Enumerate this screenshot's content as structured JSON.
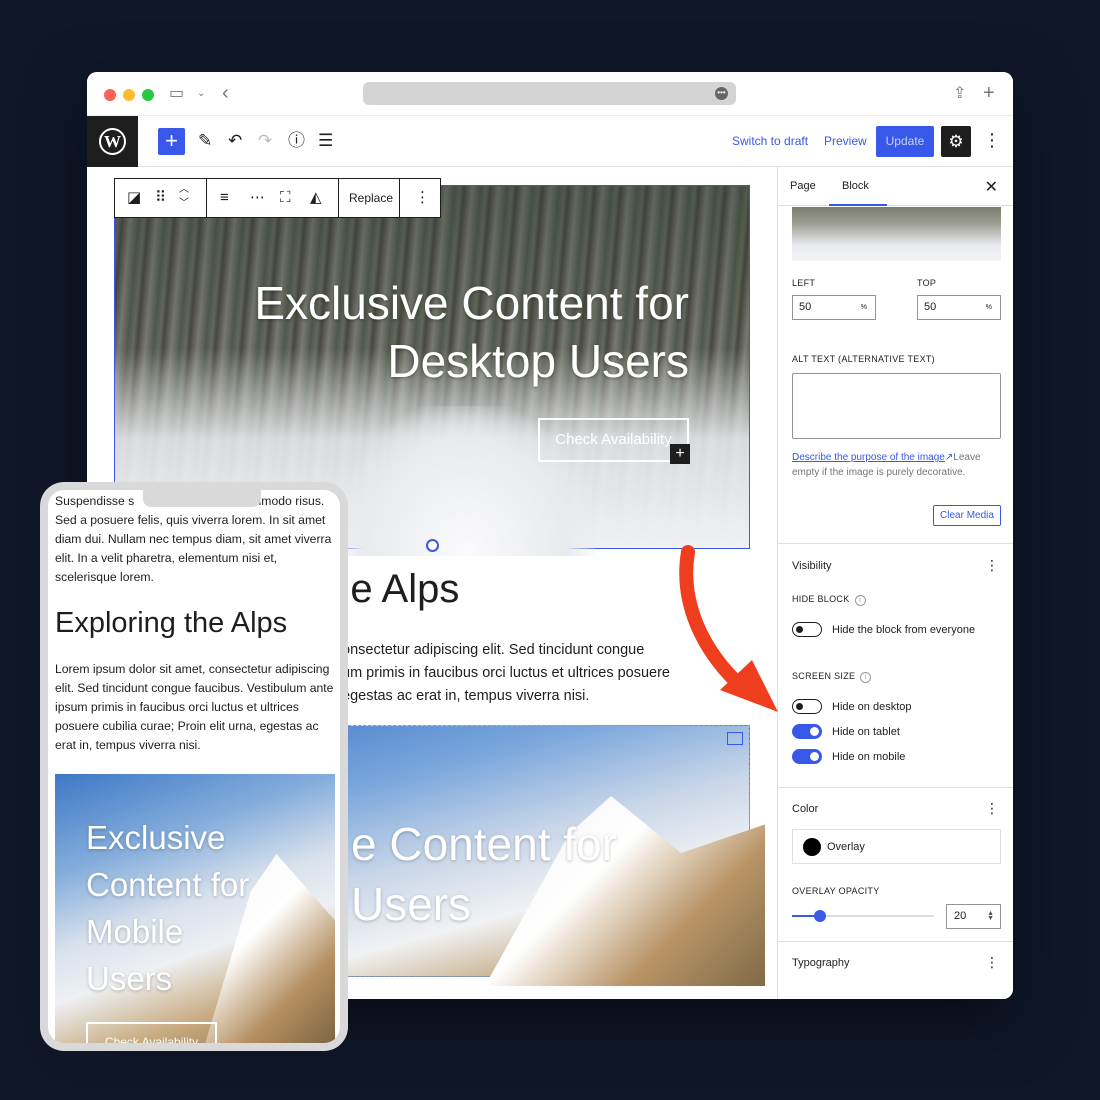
{
  "editor": {
    "toolbar": {
      "switch_to_draft": "Switch to draft",
      "preview": "Preview",
      "update": "Update"
    },
    "block_toolbar": {
      "replace": "Replace"
    },
    "canvas": {
      "cover_title_line1": "Exclusive Content for",
      "cover_title_line2": "Desktop Users",
      "cover_button": "Check Availability",
      "heading_fragment": "the Alps",
      "para_line1": "onsectetur adipiscing elit. Sed tincidunt congue",
      "para_line2": "um primis in faucibus orci luctus et ultrices posuere",
      "para_line3": "egestas ac erat in, tempus viverra nisi.",
      "cover2_title_line1": "e Content for",
      "cover2_title_line2": "Users"
    },
    "sidebar": {
      "tabs": [
        "Page",
        "Block"
      ],
      "active_tab": "Block",
      "focal_left_label": "LEFT",
      "focal_left_value": "50",
      "focal_top_label": "TOP",
      "focal_top_value": "50",
      "unit": "%",
      "alt_text_label": "ALT TEXT (ALTERNATIVE TEXT)",
      "alt_help_link": "Describe the purpose of the image",
      "alt_help_rest_1": "Leave",
      "alt_help_rest_2": "empty if the image is purely decorative.",
      "clear_media": "Clear Media",
      "visibility_title": "Visibility",
      "hide_block_label": "HIDE BLOCK",
      "hide_block_toggle": "Hide the block from everyone",
      "screen_size_label": "SCREEN SIZE",
      "toggles": [
        {
          "label": "Hide on desktop",
          "on": false
        },
        {
          "label": "Hide on tablet",
          "on": true
        },
        {
          "label": "Hide on mobile",
          "on": true
        }
      ],
      "color_title": "Color",
      "overlay_label": "Overlay",
      "overlay_color": "#000000",
      "overlay_opacity_label": "OVERLAY OPACITY",
      "overlay_opacity_value": "20",
      "typography_title": "Typography"
    }
  },
  "phone": {
    "intro_line1_a": "Suspendisse s",
    "intro_line1_b": "commodo",
    "intro_rest": "risus. Sed a posuere felis, quis viverra lorem. In sit amet diam dui. Nullam nec tempus diam, sit amet viverra elit. In a velit pharetra, elementum nisi et, scelerisque lorem.",
    "heading": "Exploring the Alps",
    "paragraph": "Lorem ipsum dolor sit amet, consectetur adipiscing elit. Sed tincidunt congue faucibus. Vestibulum ante ipsum primis in faucibus orci luctus et ultrices posuere cubilia curae; Proin elit urna, egestas ac erat in, tempus viverra nisi.",
    "cover_title_line1": "Exclusive",
    "cover_title_line2": "Content for",
    "cover_title_line3": "Mobile",
    "cover_title_line4": "Users",
    "cover_button": "Check Availability"
  },
  "colors": {
    "accent": "#3858e9",
    "background": "#0f1729",
    "arrow": "#ee3e1e"
  }
}
